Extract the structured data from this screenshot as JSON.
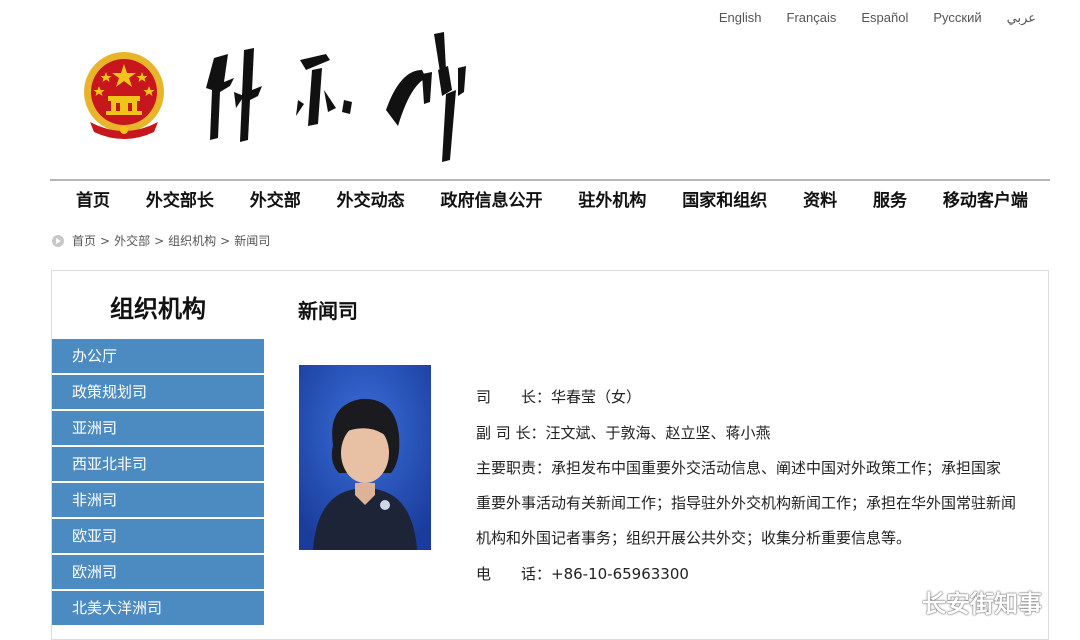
{
  "languages": [
    "English",
    "Français",
    "Español",
    "Русский",
    "عربي"
  ],
  "nav": [
    "首页",
    "外交部长",
    "外交部",
    "外交动态",
    "政府信息公开",
    "驻外机构",
    "国家和组织",
    "资料",
    "服务",
    "移动客户端"
  ],
  "breadcrumb": [
    "首页",
    "外交部",
    "组织机构",
    "新闻司"
  ],
  "breadcrumb_sep": ">",
  "sidebar": {
    "title": "组织机构",
    "items": [
      "办公厅",
      "政策规划司",
      "亚洲司",
      "西亚北非司",
      "非洲司",
      "欧亚司",
      "欧洲司",
      "北美大洋洲司"
    ]
  },
  "main": {
    "title": "新闻司",
    "rows": {
      "director_label": "司　　长：",
      "director_value": "华春莹（女）",
      "deputy_label": "副 司 长：",
      "deputy_value": "汪文斌、于敦海、赵立坚、蒋小燕",
      "duties_label": "主要职责：",
      "duties_value": "承担发布中国重要外交活动信息、阐述中国对外政策工作；承担国家重要外事活动有关新闻工作；指导驻外外交机构新闻工作；承担在华外国常驻新闻机构和外国记者事务；组织开展公共外交；收集分析重要信息等。",
      "phone_label": "电　　话：",
      "phone_value": "+86-10-65963300"
    }
  },
  "watermark": "长安街知事",
  "colors": {
    "sidebar_bg": "#4c8bc1",
    "emblem_red": "#c8161d",
    "emblem_gold": "#f0c419"
  }
}
